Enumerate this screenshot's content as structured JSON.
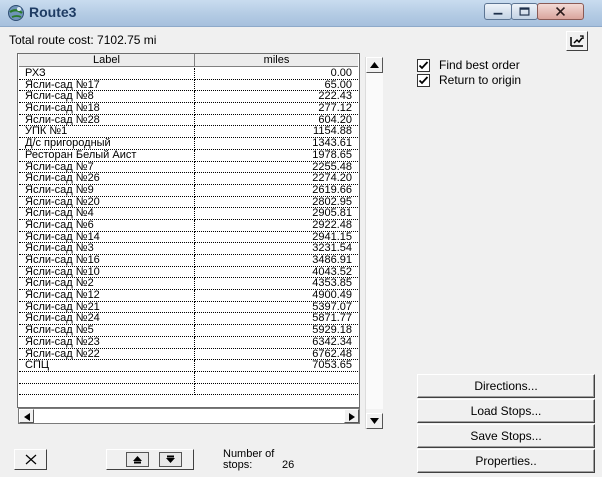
{
  "window": {
    "title": "Route3",
    "icons": {
      "app": "route-globe-icon",
      "minimize": "minimize-icon",
      "maximize": "maximize-icon",
      "close": "close-icon"
    }
  },
  "cost_text": "Total route cost: 7102.75 mi",
  "list": {
    "columns": {
      "label": "Label",
      "miles": "miles"
    },
    "rows": [
      {
        "label": "РХЗ",
        "miles": "0.00"
      },
      {
        "label": "Ясли-сад №17",
        "miles": "65.00"
      },
      {
        "label": "Ясли-сад №8",
        "miles": "222.43"
      },
      {
        "label": "Ясли-сад №18",
        "miles": "277.12"
      },
      {
        "label": "Ясли-сад №28",
        "miles": "604.20"
      },
      {
        "label": "УПК №1",
        "miles": "1154.88"
      },
      {
        "label": "Д/с пригородный",
        "miles": "1343.61"
      },
      {
        "label": "Ресторан Белый Аист",
        "miles": "1978.65"
      },
      {
        "label": "Ясли-сад №7",
        "miles": "2255.48"
      },
      {
        "label": "Ясли-сад №26",
        "miles": "2274.20"
      },
      {
        "label": "Ясли-сад №9",
        "miles": "2619.66"
      },
      {
        "label": "Ясли-сад №20",
        "miles": "2802.95"
      },
      {
        "label": "Ясли-сад №4",
        "miles": "2905.81"
      },
      {
        "label": "Ясли-сад №6",
        "miles": "2922.48"
      },
      {
        "label": "Ясли-сад №14",
        "miles": "2941.15"
      },
      {
        "label": "Ясли-сад №3",
        "miles": "3231.54"
      },
      {
        "label": "Ясли-сад №16",
        "miles": "3486.91"
      },
      {
        "label": "Ясли-сад №10",
        "miles": "4043.52"
      },
      {
        "label": "Ясли-сад №2",
        "miles": "4353.85"
      },
      {
        "label": "Ясли-сад №12",
        "miles": "4900.49"
      },
      {
        "label": "Ясли-сад №21",
        "miles": "5397.07"
      },
      {
        "label": "Ясли-сад №24",
        "miles": "5871.77"
      },
      {
        "label": "Ясли-сад №5",
        "miles": "5929.18"
      },
      {
        "label": "Ясли-сад №23",
        "miles": "6342.34"
      },
      {
        "label": "Ясли-сад №22",
        "miles": "6762.48"
      },
      {
        "label": "СПЦ",
        "miles": "7053.65"
      }
    ]
  },
  "options": [
    {
      "label": "Find best order",
      "checked": true
    },
    {
      "label": "Return to origin",
      "checked": true
    }
  ],
  "buttons": {
    "directions": "Directions...",
    "load": "Load Stops...",
    "save": "Save Stops...",
    "properties": "Properties.."
  },
  "stops": {
    "label": "Number of",
    "label2": "stops:",
    "count": "26"
  },
  "bottom_icons": {
    "delete": "delete-x-icon",
    "up": "move-up-icon",
    "down": "move-down-icon",
    "tool": "add-point-icon"
  }
}
